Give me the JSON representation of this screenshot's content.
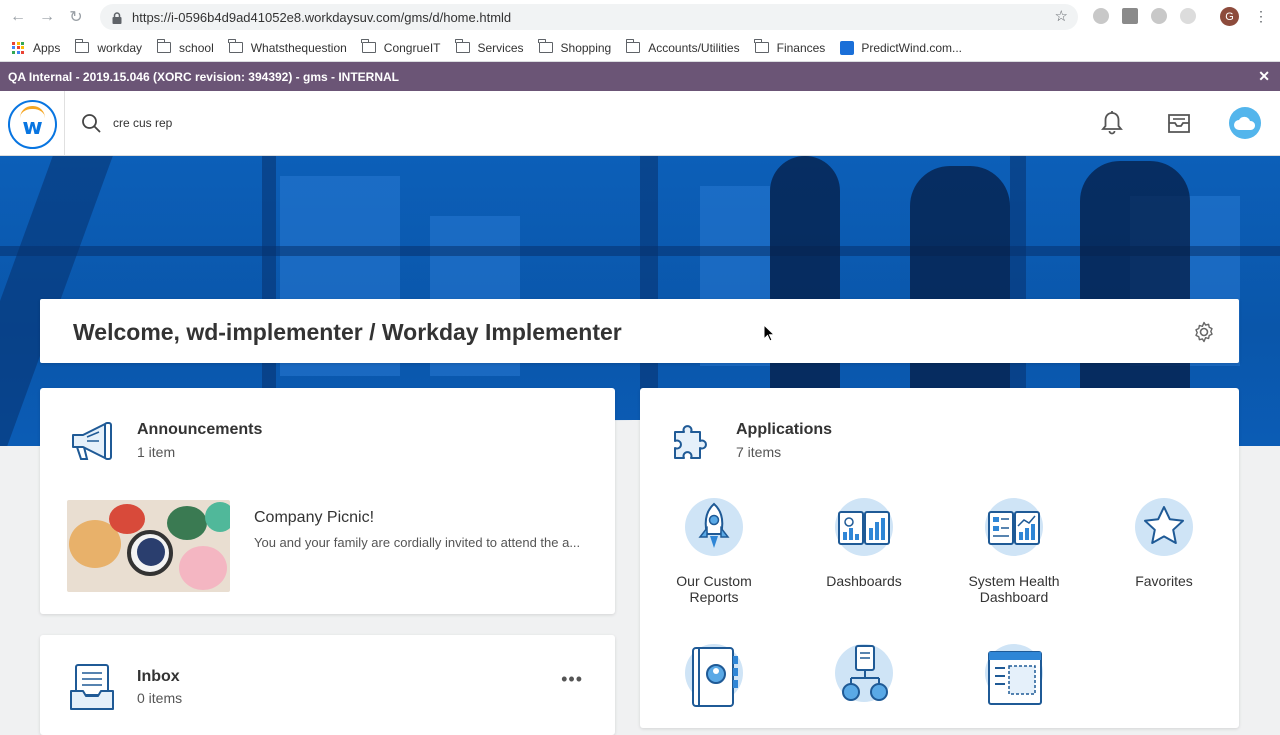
{
  "browser": {
    "url": "https://i-0596b4d9ad41052e8.workdaysuv.com/gms/d/home.htmld",
    "profile_initial": "G",
    "bookmarks": [
      {
        "label": "Apps"
      },
      {
        "label": "workday"
      },
      {
        "label": "school"
      },
      {
        "label": "Whatsthequestion"
      },
      {
        "label": "CongrueIT"
      },
      {
        "label": "Services"
      },
      {
        "label": "Shopping"
      },
      {
        "label": "Accounts/Utilities"
      },
      {
        "label": "Finances"
      },
      {
        "label": "PredictWind.com..."
      }
    ]
  },
  "banner": {
    "text": "QA Internal - 2019.15.046 (XORC revision: 394392) - gms - INTERNAL",
    "color": "#6b5576"
  },
  "header": {
    "search_value": "cre cus rep",
    "brand_color": "#0875e1"
  },
  "welcome": {
    "text": "Welcome, wd-implementer / Workday Implementer"
  },
  "announcements": {
    "title": "Announcements",
    "count": "1 item",
    "item_title": "Company Picnic!",
    "item_desc": "You and your family are cordially invited to attend the a..."
  },
  "applications": {
    "title": "Applications",
    "count": "7 items",
    "apps": [
      {
        "label": "Our Custom Reports",
        "icon": "rocket-icon"
      },
      {
        "label": "Dashboards",
        "icon": "dashboard-icon"
      },
      {
        "label": "System Health Dashboard",
        "icon": "health-dashboard-icon"
      },
      {
        "label": "Favorites",
        "icon": "star-icon"
      }
    ]
  },
  "inbox": {
    "title": "Inbox",
    "count": "0 items"
  }
}
